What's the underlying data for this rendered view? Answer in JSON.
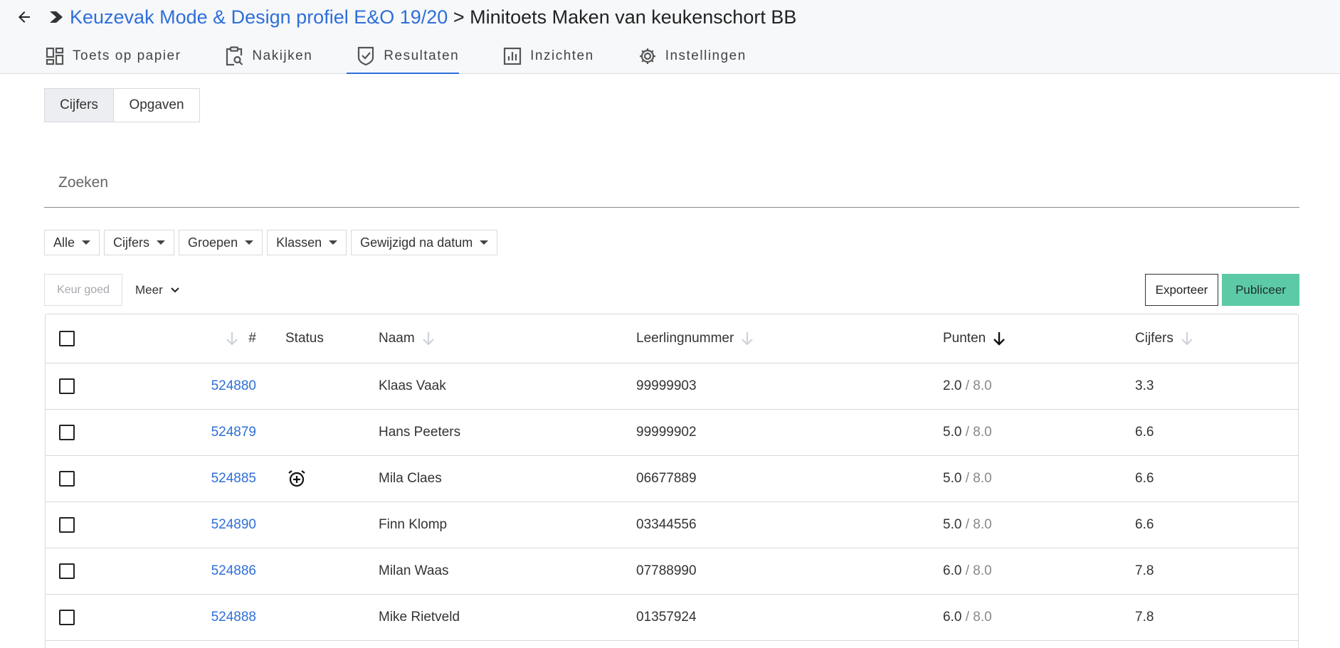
{
  "breadcrumb": {
    "course": "Keuzevak Mode & Design profiel E&O 19/20",
    "separator": ">",
    "title": "Minitoets Maken van keukenschort BB"
  },
  "tabs": [
    {
      "label": "Toets op papier",
      "icon": "dashboard-icon"
    },
    {
      "label": "Nakijken",
      "icon": "clipboard-search-icon"
    },
    {
      "label": "Resultaten",
      "icon": "shield-check-icon",
      "active": true
    },
    {
      "label": "Inzichten",
      "icon": "bar-chart-icon"
    },
    {
      "label": "Instellingen",
      "icon": "gear-icon"
    }
  ],
  "view_toggle": {
    "active": "Cijfers",
    "inactive": "Opgaven"
  },
  "search": {
    "placeholder": "Zoeken"
  },
  "filters": [
    "Alle",
    "Cijfers",
    "Groepen",
    "Klassen",
    "Gewijzigd na datum"
  ],
  "actions": {
    "keur_goed": "Keur goed",
    "meer": "Meer",
    "exporteer": "Exporteer",
    "publiceer": "Publiceer"
  },
  "colors": {
    "accent": "#2e6fd8",
    "publish": "#5ccaa6"
  },
  "table": {
    "columns": {
      "number": "#",
      "status": "Status",
      "name": "Naam",
      "student_number": "Leerlingnummer",
      "points": "Punten",
      "grades": "Cijfers"
    },
    "sorted_by": "Punten",
    "rows": [
      {
        "id": "524880",
        "status": "",
        "name": "Klaas Vaak",
        "student_number": "99999903",
        "points": "2.0",
        "max": "/ 8.0",
        "grade": "3.3"
      },
      {
        "id": "524879",
        "status": "",
        "name": "Hans Peeters",
        "student_number": "99999902",
        "points": "5.0",
        "max": "/ 8.0",
        "grade": "6.6"
      },
      {
        "id": "524885",
        "status": "alarm-add-icon",
        "name": "Mila Claes",
        "student_number": "06677889",
        "points": "5.0",
        "max": "/ 8.0",
        "grade": "6.6"
      },
      {
        "id": "524890",
        "status": "",
        "name": "Finn Klomp",
        "student_number": "03344556",
        "points": "5.0",
        "max": "/ 8.0",
        "grade": "6.6"
      },
      {
        "id": "524886",
        "status": "",
        "name": "Milan Waas",
        "student_number": "07788990",
        "points": "6.0",
        "max": "/ 8.0",
        "grade": "7.8"
      },
      {
        "id": "524888",
        "status": "",
        "name": "Mike Rietveld",
        "student_number": "01357924",
        "points": "6.0",
        "max": "/ 8.0",
        "grade": "7.8"
      }
    ]
  }
}
